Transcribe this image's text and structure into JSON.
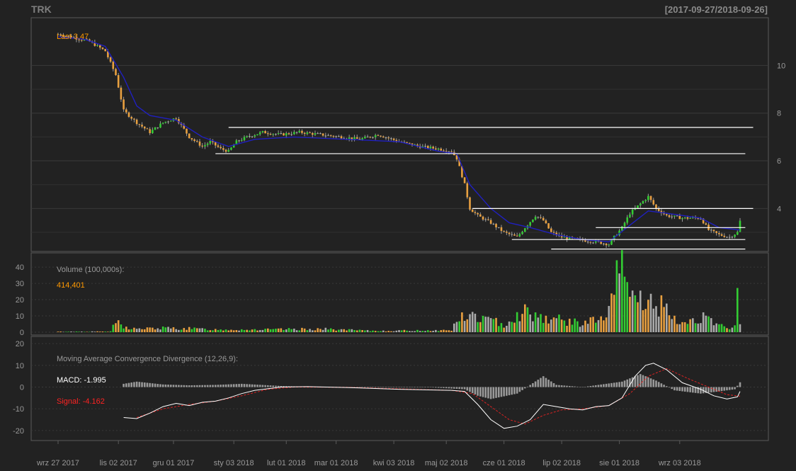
{
  "header": {
    "symbol": "TRK",
    "date_range": "[2017-09-27/2018-09-26]"
  },
  "colors": {
    "background": "#222222",
    "grid": "#3a3a3a",
    "axis_text": "#999999",
    "up_candle": "#33cc33",
    "down_candle": "#e8a040",
    "neutral_candle": "#aaaaaa",
    "sma_line": "#2020c0",
    "support_lines": "#ffffff",
    "macd_line": "#ffffff",
    "signal_line": "#dd2222",
    "histogram": "#999999",
    "last_label": "#ff9900",
    "signal_label": "#ff2222"
  },
  "price_panel": {
    "last_label": "Last 3.47",
    "y_ticks": [
      "4",
      "6",
      "8",
      "10"
    ]
  },
  "volume_panel": {
    "title": "Volume (100,000s):",
    "last_value": "414,401",
    "y_ticks": [
      "0",
      "10",
      "20",
      "30",
      "40"
    ]
  },
  "macd_panel": {
    "title": "Moving Average Convergence Divergence (12,26,9):",
    "macd_label": "MACD: -1.995",
    "signal_label": "Signal: -4.162",
    "y_ticks": [
      "-20",
      "-10",
      "0",
      "10",
      "20"
    ]
  },
  "x_axis": {
    "labels": [
      "wrz 27 2017",
      "lis 02 2017",
      "gru 01 2017",
      "sty 03 2018",
      "lut 01 2018",
      "mar 01 2018",
      "kwi 03 2018",
      "maj 02 2018",
      "cze 01 2018",
      "lip 02 2018",
      "sie 01 2018",
      "wrz 03 2018"
    ]
  },
  "chart_data": [
    {
      "type": "candlestick",
      "panel": "price",
      "series_name": "TRK",
      "last": 3.47,
      "ylim": [
        2.2,
        12
      ],
      "y_ticks": [
        4,
        6,
        8,
        10
      ],
      "close_points": [
        [
          0,
          11.3
        ],
        [
          5,
          11.2
        ],
        [
          12,
          11.0
        ],
        [
          18,
          10.6
        ],
        [
          22,
          9.6
        ],
        [
          25,
          8.1
        ],
        [
          30,
          7.6
        ],
        [
          35,
          7.2
        ],
        [
          40,
          7.6
        ],
        [
          45,
          7.8
        ],
        [
          50,
          7.0
        ],
        [
          55,
          6.6
        ],
        [
          58,
          6.8
        ],
        [
          62,
          6.5
        ],
        [
          65,
          6.4
        ],
        [
          68,
          6.8
        ],
        [
          72,
          7.0
        ],
        [
          78,
          7.2
        ],
        [
          85,
          7.1
        ],
        [
          92,
          7.2
        ],
        [
          100,
          7.1
        ],
        [
          108,
          7.0
        ],
        [
          115,
          6.9
        ],
        [
          122,
          7.1
        ],
        [
          130,
          6.8
        ],
        [
          138,
          6.6
        ],
        [
          145,
          6.5
        ],
        [
          150,
          6.4
        ],
        [
          152,
          6.1
        ],
        [
          155,
          5.0
        ],
        [
          157,
          4.0
        ],
        [
          160,
          3.7
        ],
        [
          165,
          3.4
        ],
        [
          170,
          3.0
        ],
        [
          175,
          2.8
        ],
        [
          178,
          3.2
        ],
        [
          182,
          3.7
        ],
        [
          185,
          3.5
        ],
        [
          188,
          3.0
        ],
        [
          192,
          2.8
        ],
        [
          198,
          2.7
        ],
        [
          205,
          2.6
        ],
        [
          210,
          2.5
        ],
        [
          212,
          2.8
        ],
        [
          215,
          3.2
        ],
        [
          218,
          3.8
        ],
        [
          222,
          4.2
        ],
        [
          225,
          4.5
        ],
        [
          228,
          4.0
        ],
        [
          232,
          3.7
        ],
        [
          238,
          3.6
        ],
        [
          245,
          3.6
        ],
        [
          248,
          3.1
        ],
        [
          252,
          2.9
        ],
        [
          256,
          2.8
        ],
        [
          259,
          3.0
        ],
        [
          260,
          3.47
        ]
      ],
      "sma_points": [
        [
          0,
          11.2
        ],
        [
          10,
          11.1
        ],
        [
          18,
          10.8
        ],
        [
          25,
          9.5
        ],
        [
          30,
          8.3
        ],
        [
          35,
          7.9
        ],
        [
          45,
          7.7
        ],
        [
          55,
          7.0
        ],
        [
          65,
          6.6
        ],
        [
          75,
          6.9
        ],
        [
          90,
          7.0
        ],
        [
          110,
          6.9
        ],
        [
          130,
          6.8
        ],
        [
          145,
          6.4
        ],
        [
          152,
          6.3
        ],
        [
          157,
          5.0
        ],
        [
          165,
          4.0
        ],
        [
          172,
          3.4
        ],
        [
          180,
          3.2
        ],
        [
          190,
          2.9
        ],
        [
          200,
          2.7
        ],
        [
          210,
          2.6
        ],
        [
          218,
          3.3
        ],
        [
          225,
          3.9
        ],
        [
          232,
          3.8
        ],
        [
          245,
          3.6
        ],
        [
          252,
          3.2
        ],
        [
          260,
          3.1
        ]
      ],
      "horizontal_lines": [
        {
          "from": 65,
          "to": 265,
          "level": 7.4
        },
        {
          "from": 60,
          "to": 262,
          "level": 6.3
        },
        {
          "from": 158,
          "to": 265,
          "level": 4.0
        },
        {
          "from": 205,
          "to": 262,
          "level": 3.2
        },
        {
          "from": 173,
          "to": 262,
          "level": 2.7
        },
        {
          "from": 188,
          "to": 262,
          "level": 2.3
        }
      ]
    },
    {
      "type": "bar",
      "panel": "volume",
      "title": "Volume (100,000s):",
      "ylim": [
        0,
        47
      ],
      "y_ticks": [
        0,
        10,
        20,
        30,
        40
      ],
      "profile": [
        [
          0,
          0.3
        ],
        [
          20,
          0.4
        ],
        [
          22,
          6.5
        ],
        [
          25,
          3
        ],
        [
          30,
          2
        ],
        [
          40,
          2.5
        ],
        [
          50,
          2.2
        ],
        [
          60,
          1.6
        ],
        [
          80,
          1.6
        ],
        [
          100,
          2
        ],
        [
          120,
          0.8
        ],
        [
          150,
          1.2
        ],
        [
          152,
          8
        ],
        [
          158,
          10
        ],
        [
          165,
          7
        ],
        [
          170,
          5
        ],
        [
          178,
          13
        ],
        [
          185,
          9
        ],
        [
          190,
          8
        ],
        [
          198,
          5.5
        ],
        [
          208,
          8
        ],
        [
          212,
          20
        ],
        [
          214,
          46
        ],
        [
          216,
          28
        ],
        [
          220,
          22
        ],
        [
          225,
          18
        ],
        [
          230,
          16
        ],
        [
          235,
          7
        ],
        [
          240,
          6
        ],
        [
          245,
          10
        ],
        [
          250,
          5
        ],
        [
          255,
          2.5
        ],
        [
          258,
          4
        ],
        [
          259,
          20
        ],
        [
          260,
          4.1
        ]
      ]
    },
    {
      "type": "line",
      "panel": "macd",
      "title": "Moving Average Convergence Divergence (12,26,9):",
      "ylim": [
        -22,
        22
      ],
      "y_ticks": [
        -20,
        -10,
        0,
        10,
        20
      ],
      "macd_last": -1.995,
      "signal_last": -4.162,
      "macd_points": [
        [
          25,
          -14
        ],
        [
          30,
          -14.5
        ],
        [
          35,
          -12
        ],
        [
          40,
          -9
        ],
        [
          45,
          -7.5
        ],
        [
          50,
          -8.5
        ],
        [
          55,
          -7
        ],
        [
          60,
          -6.5
        ],
        [
          65,
          -5
        ],
        [
          70,
          -3
        ],
        [
          75,
          -1.5
        ],
        [
          85,
          0
        ],
        [
          95,
          0.2
        ],
        [
          110,
          -0.2
        ],
        [
          130,
          -1
        ],
        [
          150,
          -1.5
        ],
        [
          155,
          -2
        ],
        [
          160,
          -8
        ],
        [
          165,
          -15
        ],
        [
          170,
          -19
        ],
        [
          175,
          -18
        ],
        [
          180,
          -15
        ],
        [
          185,
          -8
        ],
        [
          190,
          -9
        ],
        [
          195,
          -10
        ],
        [
          200,
          -10.5
        ],
        [
          205,
          -9
        ],
        [
          210,
          -8.5
        ],
        [
          215,
          -5
        ],
        [
          220,
          5
        ],
        [
          224,
          10
        ],
        [
          227,
          11
        ],
        [
          232,
          8
        ],
        [
          238,
          2
        ],
        [
          245,
          -1
        ],
        [
          250,
          -4
        ],
        [
          255,
          -5.5
        ],
        [
          259,
          -4.5
        ],
        [
          260,
          -1.995
        ]
      ],
      "signal_points": [
        [
          30,
          -14
        ],
        [
          40,
          -10
        ],
        [
          50,
          -8
        ],
        [
          60,
          -6.5
        ],
        [
          70,
          -4
        ],
        [
          80,
          -1
        ],
        [
          90,
          0
        ],
        [
          110,
          -0.1
        ],
        [
          130,
          -0.8
        ],
        [
          150,
          -1.5
        ],
        [
          158,
          -3
        ],
        [
          165,
          -9
        ],
        [
          172,
          -15
        ],
        [
          178,
          -17
        ],
        [
          185,
          -13
        ],
        [
          192,
          -10.5
        ],
        [
          200,
          -10
        ],
        [
          210,
          -8.5
        ],
        [
          218,
          -3
        ],
        [
          225,
          5
        ],
        [
          232,
          8.5
        ],
        [
          240,
          4
        ],
        [
          250,
          -1
        ],
        [
          255,
          -3.5
        ],
        [
          260,
          -4.162
        ]
      ],
      "histogram_profile": [
        [
          25,
          1.5
        ],
        [
          30,
          2.5
        ],
        [
          40,
          1.2
        ],
        [
          50,
          0.8
        ],
        [
          60,
          1
        ],
        [
          70,
          1.5
        ],
        [
          85,
          0.5
        ],
        [
          100,
          0
        ],
        [
          140,
          0
        ],
        [
          155,
          -1
        ],
        [
          160,
          -4
        ],
        [
          165,
          -5.5
        ],
        [
          175,
          -3
        ],
        [
          180,
          1
        ],
        [
          185,
          5
        ],
        [
          190,
          1
        ],
        [
          200,
          0
        ],
        [
          215,
          2.5
        ],
        [
          222,
          6
        ],
        [
          228,
          3
        ],
        [
          235,
          -1.5
        ],
        [
          245,
          -3
        ],
        [
          252,
          -2
        ],
        [
          258,
          -1
        ],
        [
          260,
          2.2
        ]
      ]
    }
  ]
}
